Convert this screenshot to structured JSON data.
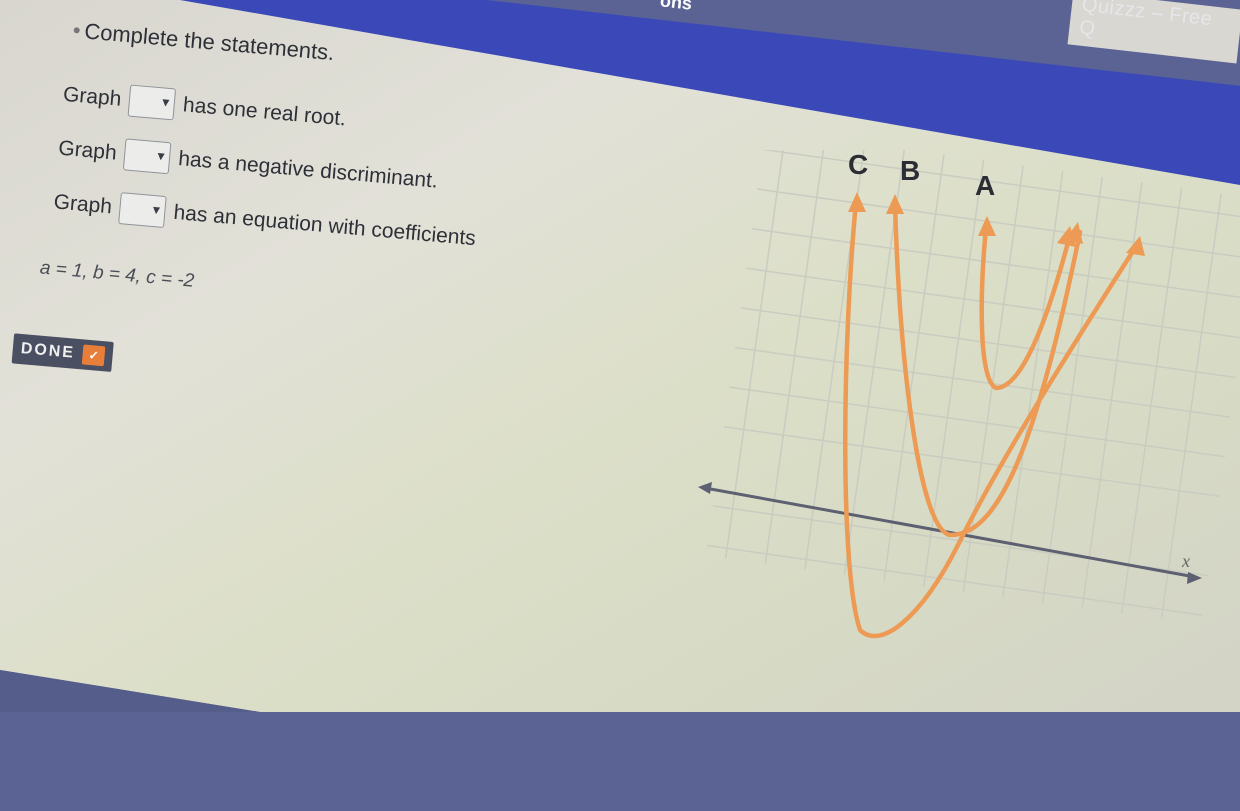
{
  "window": {
    "title_fragment": "Quizzz – Free Q",
    "tab_fragment": "ons"
  },
  "question": {
    "instruction": "Complete the statements.",
    "statements": [
      {
        "prefix": "Graph",
        "suffix": "has one real root."
      },
      {
        "prefix": "Graph",
        "suffix": "has a negative discriminant."
      },
      {
        "prefix": "Graph",
        "suffix": "has an equation with coefficients"
      }
    ],
    "coefficients_text": "a = 1, b = 4, c = -2",
    "done_label": "DONE"
  },
  "graph": {
    "curve_labels": [
      "C",
      "B",
      "A"
    ],
    "x_axis_label": "x",
    "curve_color": "#ec9a54"
  },
  "colors": {
    "topbar": "#3b49b8",
    "done_button": "#4a4f61",
    "done_check": "#e77f3a"
  }
}
